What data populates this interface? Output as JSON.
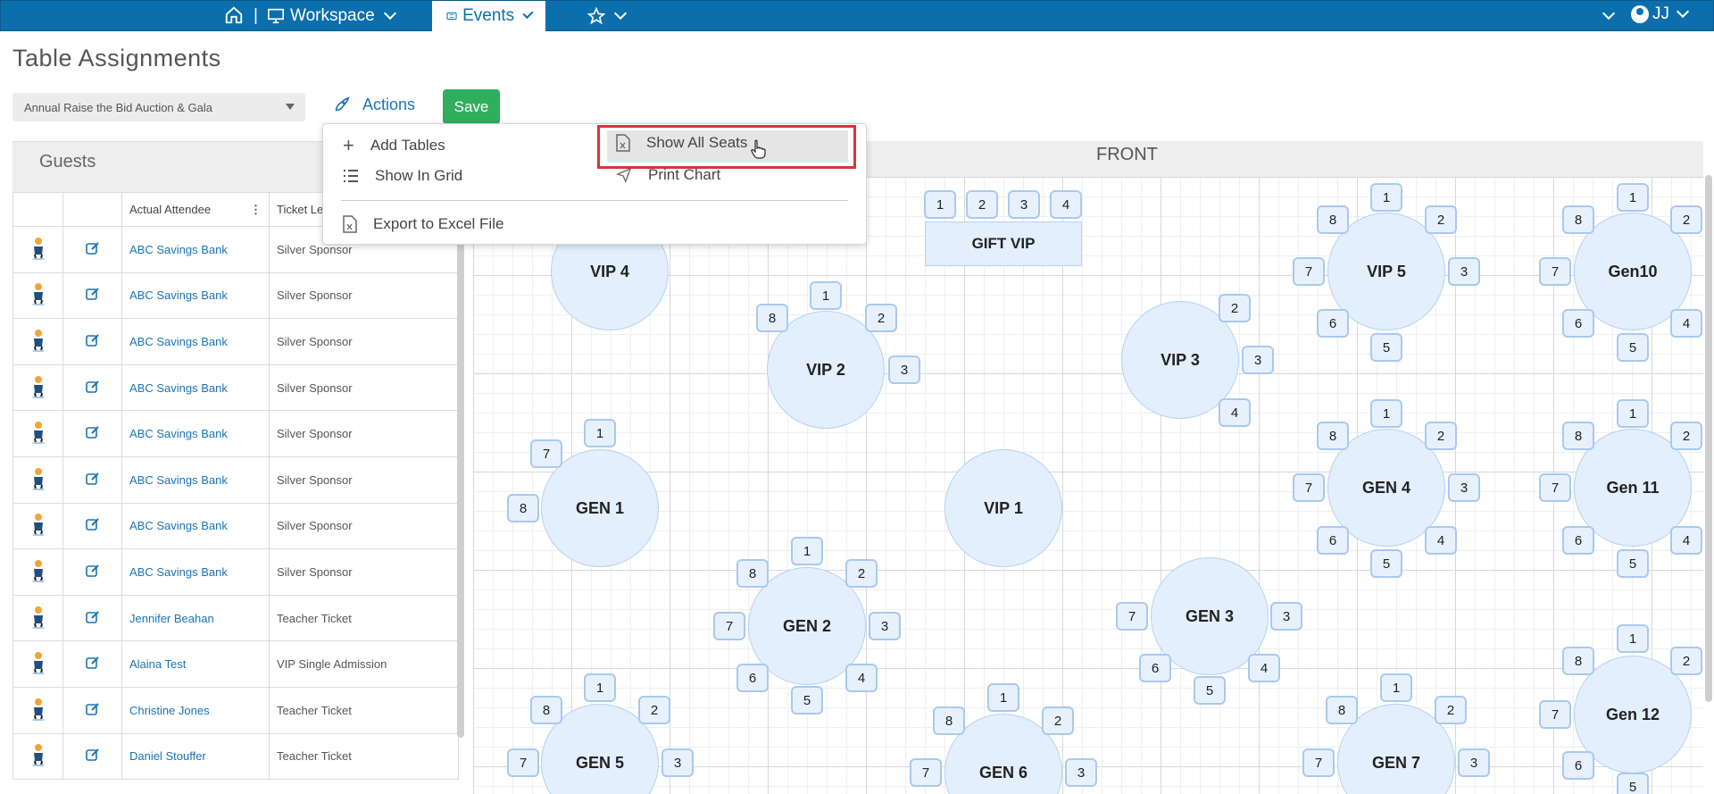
{
  "nav": {
    "items": [
      {
        "label": "Workspace",
        "icon": "monitor-icon"
      },
      {
        "label": "Events",
        "icon": "ticket-icon"
      },
      {
        "label": "",
        "icon": "star-icon"
      }
    ],
    "user_initials": "JJ"
  },
  "page": {
    "title": "Table Assignments",
    "event_selected": "Annual Raise the Bid Auction & Gala",
    "actions_label": "Actions",
    "save_label": "Save"
  },
  "guests": {
    "title": "Guests",
    "columns": [
      "Actual Attendee",
      "Ticket Le"
    ],
    "rows": [
      {
        "attendee": "ABC Savings Bank",
        "ticket": "Silver Sponsor"
      },
      {
        "attendee": "ABC Savings Bank",
        "ticket": "Silver Sponsor"
      },
      {
        "attendee": "ABC Savings Bank",
        "ticket": "Silver Sponsor"
      },
      {
        "attendee": "ABC Savings Bank",
        "ticket": "Silver Sponsor"
      },
      {
        "attendee": "ABC Savings Bank",
        "ticket": "Silver Sponsor"
      },
      {
        "attendee": "ABC Savings Bank",
        "ticket": "Silver Sponsor"
      },
      {
        "attendee": "ABC Savings Bank",
        "ticket": "Silver Sponsor"
      },
      {
        "attendee": "ABC Savings Bank",
        "ticket": "Silver Sponsor"
      },
      {
        "attendee": "Jennifer Beahan",
        "ticket": "Teacher Ticket"
      },
      {
        "attendee": "Alaina Test",
        "ticket": "VIP Single Admission"
      },
      {
        "attendee": "Christine Jones",
        "ticket": "Teacher Ticket"
      },
      {
        "attendee": "Daniel Stouffer",
        "ticket": "Teacher Ticket"
      }
    ]
  },
  "menu": {
    "add_tables": "Add Tables",
    "show_in_grid": "Show In Grid",
    "export_excel": "Export to Excel File",
    "show_all_seats": "Show All Seats",
    "print_chart": "Print Chart"
  },
  "canvas": {
    "front_label": "FRONT",
    "tables": [
      {
        "name": "GIFT VIP",
        "seats": [
          "1",
          "2",
          "3",
          "4"
        ]
      },
      {
        "name": "VIP 4",
        "seats": []
      },
      {
        "name": "VIP 2",
        "seats": [
          "1",
          "2",
          "3",
          "8"
        ]
      },
      {
        "name": "VIP 3",
        "seats": [
          "2",
          "3",
          "4"
        ]
      },
      {
        "name": "VIP 5",
        "seats": [
          "1",
          "2",
          "3",
          "5",
          "6",
          "7",
          "8"
        ]
      },
      {
        "name": "Gen10",
        "seats": [
          "1",
          "2",
          "4",
          "5",
          "6",
          "7",
          "8"
        ]
      },
      {
        "name": "GEN 1",
        "seats": [
          "1",
          "7",
          "8"
        ]
      },
      {
        "name": "VIP 1",
        "seats": []
      },
      {
        "name": "GEN 4",
        "seats": [
          "1",
          "2",
          "3",
          "4",
          "5",
          "6",
          "7",
          "8"
        ]
      },
      {
        "name": "Gen 11",
        "seats": [
          "1",
          "2",
          "4",
          "5",
          "6",
          "7",
          "8"
        ]
      },
      {
        "name": "GEN 2",
        "seats": [
          "1",
          "2",
          "3",
          "4",
          "5",
          "6",
          "7",
          "8"
        ]
      },
      {
        "name": "GEN 3",
        "seats": [
          "3",
          "4",
          "5",
          "6",
          "7"
        ]
      },
      {
        "name": "GEN 5",
        "seats": [
          "1",
          "2",
          "3",
          "7",
          "8"
        ]
      },
      {
        "name": "GEN 6",
        "seats": [
          "1",
          "2",
          "3",
          "7",
          "8"
        ]
      },
      {
        "name": "GEN 7",
        "seats": [
          "1",
          "2",
          "3",
          "7",
          "8"
        ]
      },
      {
        "name": "Gen 12",
        "seats": [
          "1",
          "2",
          "5",
          "6",
          "7",
          "8"
        ]
      }
    ]
  }
}
